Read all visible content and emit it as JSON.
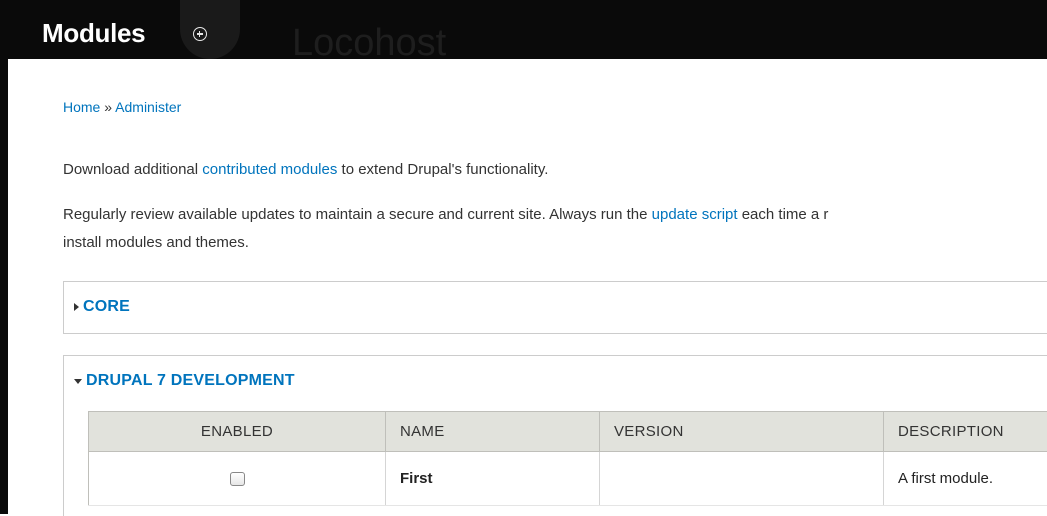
{
  "overlay": {
    "title": "Modules",
    "background_site_name": "Locohost"
  },
  "breadcrumb": {
    "home": "Home",
    "separator": " » ",
    "administer": "Administer"
  },
  "intro": {
    "download_prefix": "Download additional ",
    "download_link": "contributed modules",
    "download_suffix": " to extend Drupal's functionality.",
    "updates_prefix": "Regularly review available updates to maintain a secure and current site. Always run the ",
    "updates_link": "update script",
    "updates_suffix": " each time a r",
    "updates_line2": "install modules and themes."
  },
  "fieldsets": {
    "core": {
      "label": "CORE",
      "state": "collapsed"
    },
    "dev": {
      "label": "DRUPAL 7 DEVELOPMENT",
      "state": "expanded"
    }
  },
  "table": {
    "headers": {
      "enabled": "ENABLED",
      "name": "NAME",
      "version": "VERSION",
      "description": "DESCRIPTION"
    },
    "rows": [
      {
        "enabled": false,
        "name": "First",
        "version": "",
        "description": "A first module."
      }
    ]
  },
  "colors": {
    "link": "#0074bd",
    "overlay_bg": "#0a0a0a",
    "table_header_bg": "#e1e2dc"
  }
}
